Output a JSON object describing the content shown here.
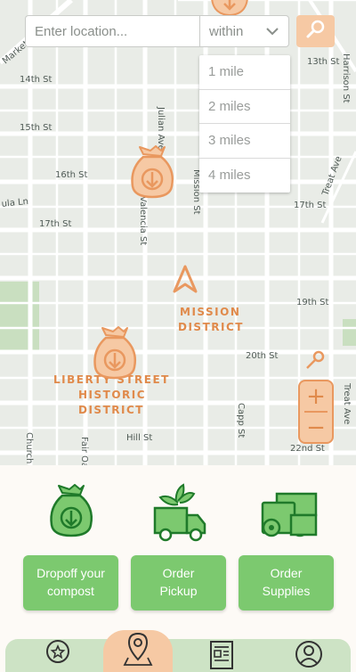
{
  "search": {
    "placeholder": "Enter location...",
    "within_label": "within",
    "distance_options": [
      "1 mile",
      "2 miles",
      "3 miles",
      "4 miles"
    ]
  },
  "map": {
    "streets": {
      "market": "Market",
      "14th": "14th St",
      "15th": "15th St",
      "16th": "16th St",
      "17th_left": "17th St",
      "17th_right": "17th St",
      "13th": "13th St",
      "19th": "19th St",
      "20th": "20th St",
      "hill": "Hill St",
      "22nd": "22nd St",
      "harrison": "Harrison St",
      "julian": "Julian Ave",
      "mission": "Mission St",
      "treat": "Treat Ave",
      "capp": "Capp St",
      "valencia": "Valencia St",
      "church": "Church",
      "fair": "Fair Oaks St",
      "ula": "ula Ln"
    },
    "districts": {
      "mission_line1": "MISSION",
      "mission_line2": "DISTRICT",
      "liberty_line1": "LIBERTY STREET",
      "liberty_line2": "HISTORIC",
      "liberty_line3": "DISTRICT"
    },
    "zoom_in": "+",
    "zoom_out": "−"
  },
  "actions": [
    {
      "label_line1": "Dropoff your",
      "label_line2": "compost"
    },
    {
      "label_line1": "Order",
      "label_line2": "Pickup"
    },
    {
      "label_line1": "Order",
      "label_line2": "Supplies"
    }
  ],
  "colors": {
    "accent_orange": "#e9985f",
    "accent_peach": "#f6c9a4",
    "button_green": "#7cc96f",
    "icon_green": "#1f8a2e",
    "tab_bar": "#cde3c5"
  },
  "icons": {
    "search": "magnifier-icon",
    "compost_bag": "compost-bag-icon",
    "truck": "pickup-truck-icon",
    "supplies": "bag-rolls-icon",
    "location": "navigation-arrow-icon"
  }
}
